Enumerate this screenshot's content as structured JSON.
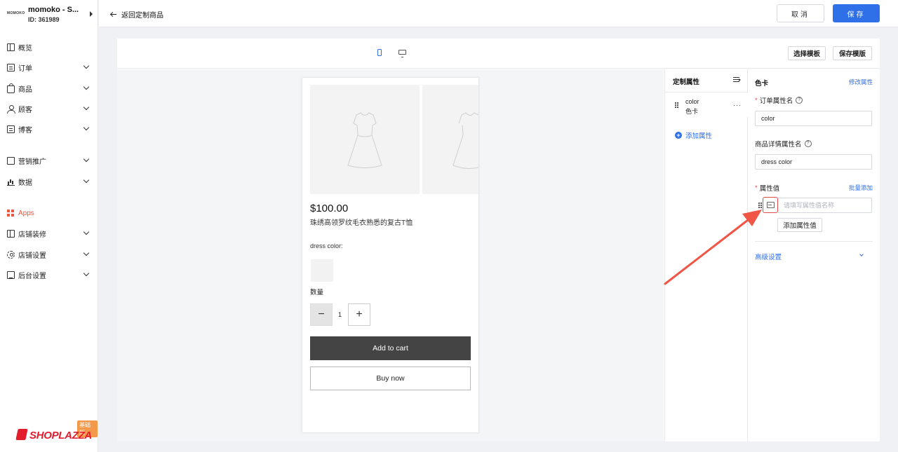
{
  "store": {
    "logo_text": "MOMOKO",
    "name": "momoko - S...",
    "id": "ID: 361989"
  },
  "nav": [
    {
      "label": "概览",
      "icon": "overview-icon"
    },
    {
      "label": "订单",
      "icon": "orders-icon"
    },
    {
      "label": "商品",
      "icon": "products-icon"
    },
    {
      "label": "顾客",
      "icon": "customers-icon"
    },
    {
      "label": "博客",
      "icon": "blog-icon"
    },
    {
      "label": "营销推广",
      "icon": "marketing-icon"
    },
    {
      "label": "数据",
      "icon": "analytics-icon"
    },
    {
      "label": "Apps",
      "icon": "apps-icon"
    },
    {
      "label": "店铺装修",
      "icon": "store-design-icon"
    },
    {
      "label": "店铺设置",
      "icon": "store-settings-icon"
    },
    {
      "label": "后台设置",
      "icon": "admin-settings-icon"
    }
  ],
  "brand": {
    "name": "SHOPLAZZA",
    "badge": "基础版"
  },
  "topbar": {
    "back_label": "返回定制商品",
    "cancel_label": "取消",
    "save_label": "保存"
  },
  "editor": {
    "select_template": "选择模板",
    "save_template": "保存模版"
  },
  "preview": {
    "price": "$100.00",
    "title": "珠绣高领罗纹毛衣熟悉的复古T恤",
    "option_label": "dress color:",
    "qty_label": "数量",
    "qty_minus": "−",
    "qty_value": "1",
    "qty_plus": "+",
    "add_to_cart": "Add to cart",
    "buy_now": "Buy now"
  },
  "attr_panel": {
    "title": "定制属性",
    "items": [
      {
        "name": "color",
        "type": "色卡",
        "more": "···"
      }
    ],
    "add_label": "添加属性"
  },
  "prop_panel": {
    "title": "色卡",
    "edit_link": "修改属性",
    "order_attr_label": "订单属性名",
    "order_attr_value": "color",
    "detail_attr_label": "商品详情属性名",
    "detail_attr_value": "dress color",
    "values_label": "属性值",
    "bulk_add": "批量添加",
    "value_placeholder": "请填写属性值名称",
    "add_value_label": "添加属性值",
    "advanced_label": "高级设置"
  },
  "colors": {
    "accent": "#2f6fe8",
    "danger": "#e5484d",
    "brand": "#e11d2e",
    "apps": "#e9573f"
  }
}
